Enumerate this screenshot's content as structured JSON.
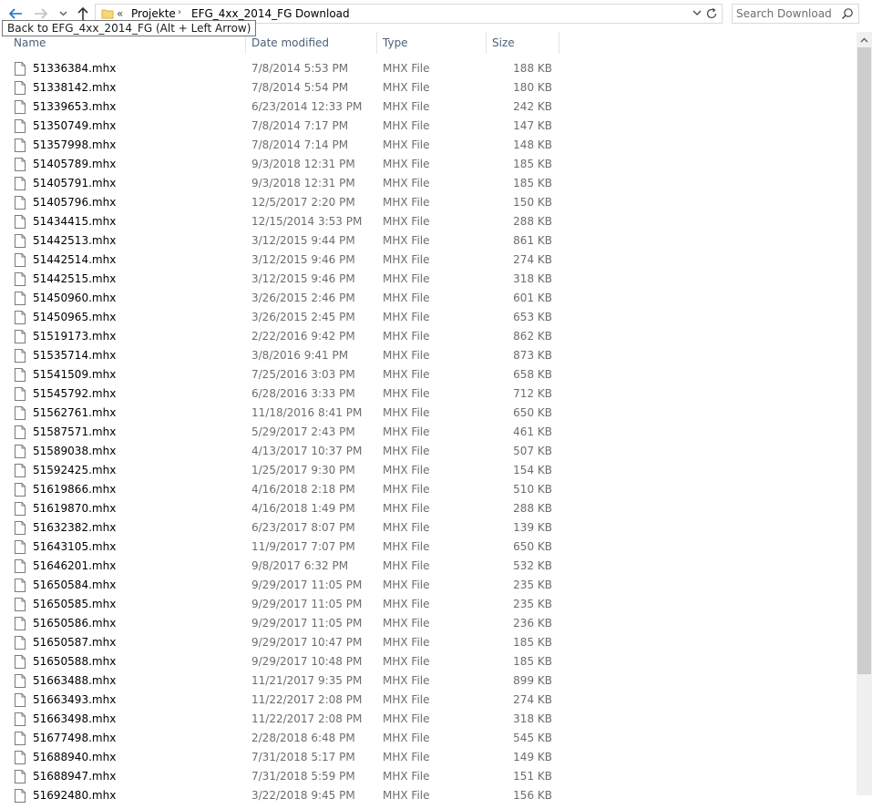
{
  "nav": {
    "back_icon": "arrow-left-icon",
    "forward_icon": "arrow-right-icon",
    "recent_icon": "chevron-down-icon",
    "up_icon": "arrow-up-icon"
  },
  "address": {
    "overflow": "«",
    "crumbs": [
      "Projekte",
      "EFG_4xx_2014_FG",
      "Download"
    ],
    "separator": "›"
  },
  "search": {
    "placeholder": "Search Download"
  },
  "tooltip": "Back to EFG_4xx_2014_FG (Alt + Left Arrow)",
  "columns": {
    "name": "Name",
    "date": "Date modified",
    "type": "Type",
    "size": "Size"
  },
  "files": [
    {
      "name": "51336384.mhx",
      "date": "7/8/2014 5:53 PM",
      "type": "MHX File",
      "size": "188 KB"
    },
    {
      "name": "51338142.mhx",
      "date": "7/8/2014 5:54 PM",
      "type": "MHX File",
      "size": "180 KB"
    },
    {
      "name": "51339653.mhx",
      "date": "6/23/2014 12:33 PM",
      "type": "MHX File",
      "size": "242 KB"
    },
    {
      "name": "51350749.mhx",
      "date": "7/8/2014 7:17 PM",
      "type": "MHX File",
      "size": "147 KB"
    },
    {
      "name": "51357998.mhx",
      "date": "7/8/2014 7:14 PM",
      "type": "MHX File",
      "size": "148 KB"
    },
    {
      "name": "51405789.mhx",
      "date": "9/3/2018 12:31 PM",
      "type": "MHX File",
      "size": "185 KB"
    },
    {
      "name": "51405791.mhx",
      "date": "9/3/2018 12:31 PM",
      "type": "MHX File",
      "size": "185 KB"
    },
    {
      "name": "51405796.mhx",
      "date": "12/5/2017 2:20 PM",
      "type": "MHX File",
      "size": "150 KB"
    },
    {
      "name": "51434415.mhx",
      "date": "12/15/2014 3:53 PM",
      "type": "MHX File",
      "size": "288 KB"
    },
    {
      "name": "51442513.mhx",
      "date": "3/12/2015 9:44 PM",
      "type": "MHX File",
      "size": "861 KB"
    },
    {
      "name": "51442514.mhx",
      "date": "3/12/2015 9:46 PM",
      "type": "MHX File",
      "size": "274 KB"
    },
    {
      "name": "51442515.mhx",
      "date": "3/12/2015 9:46 PM",
      "type": "MHX File",
      "size": "318 KB"
    },
    {
      "name": "51450960.mhx",
      "date": "3/26/2015 2:46 PM",
      "type": "MHX File",
      "size": "601 KB"
    },
    {
      "name": "51450965.mhx",
      "date": "3/26/2015 2:45 PM",
      "type": "MHX File",
      "size": "653 KB"
    },
    {
      "name": "51519173.mhx",
      "date": "2/22/2016 9:42 PM",
      "type": "MHX File",
      "size": "862 KB"
    },
    {
      "name": "51535714.mhx",
      "date": "3/8/2016 9:41 PM",
      "type": "MHX File",
      "size": "873 KB"
    },
    {
      "name": "51541509.mhx",
      "date": "7/25/2016 3:03 PM",
      "type": "MHX File",
      "size": "658 KB"
    },
    {
      "name": "51545792.mhx",
      "date": "6/28/2016 3:33 PM",
      "type": "MHX File",
      "size": "712 KB"
    },
    {
      "name": "51562761.mhx",
      "date": "11/18/2016 8:41 PM",
      "type": "MHX File",
      "size": "650 KB"
    },
    {
      "name": "51587571.mhx",
      "date": "5/29/2017 2:43 PM",
      "type": "MHX File",
      "size": "461 KB"
    },
    {
      "name": "51589038.mhx",
      "date": "4/13/2017 10:37 PM",
      "type": "MHX File",
      "size": "507 KB"
    },
    {
      "name": "51592425.mhx",
      "date": "1/25/2017 9:30 PM",
      "type": "MHX File",
      "size": "154 KB"
    },
    {
      "name": "51619866.mhx",
      "date": "4/16/2018 2:18 PM",
      "type": "MHX File",
      "size": "510 KB"
    },
    {
      "name": "51619870.mhx",
      "date": "4/16/2018 1:49 PM",
      "type": "MHX File",
      "size": "288 KB"
    },
    {
      "name": "51632382.mhx",
      "date": "6/23/2017 8:07 PM",
      "type": "MHX File",
      "size": "139 KB"
    },
    {
      "name": "51643105.mhx",
      "date": "11/9/2017 7:07 PM",
      "type": "MHX File",
      "size": "650 KB"
    },
    {
      "name": "51646201.mhx",
      "date": "9/8/2017 6:32 PM",
      "type": "MHX File",
      "size": "532 KB"
    },
    {
      "name": "51650584.mhx",
      "date": "9/29/2017 11:05 PM",
      "type": "MHX File",
      "size": "235 KB"
    },
    {
      "name": "51650585.mhx",
      "date": "9/29/2017 11:05 PM",
      "type": "MHX File",
      "size": "235 KB"
    },
    {
      "name": "51650586.mhx",
      "date": "9/29/2017 11:05 PM",
      "type": "MHX File",
      "size": "236 KB"
    },
    {
      "name": "51650587.mhx",
      "date": "9/29/2017 10:47 PM",
      "type": "MHX File",
      "size": "185 KB"
    },
    {
      "name": "51650588.mhx",
      "date": "9/29/2017 10:48 PM",
      "type": "MHX File",
      "size": "185 KB"
    },
    {
      "name": "51663488.mhx",
      "date": "11/21/2017 9:35 PM",
      "type": "MHX File",
      "size": "899 KB"
    },
    {
      "name": "51663493.mhx",
      "date": "11/22/2017 2:08 PM",
      "type": "MHX File",
      "size": "274 KB"
    },
    {
      "name": "51663498.mhx",
      "date": "11/22/2017 2:08 PM",
      "type": "MHX File",
      "size": "318 KB"
    },
    {
      "name": "51677498.mhx",
      "date": "2/28/2018 6:48 PM",
      "type": "MHX File",
      "size": "545 KB"
    },
    {
      "name": "51688940.mhx",
      "date": "7/31/2018 5:17 PM",
      "type": "MHX File",
      "size": "149 KB"
    },
    {
      "name": "51688947.mhx",
      "date": "7/31/2018 5:59 PM",
      "type": "MHX File",
      "size": "151 KB"
    },
    {
      "name": "51692480.mhx",
      "date": "3/22/2018 9:45 PM",
      "type": "MHX File",
      "size": "156 KB"
    }
  ],
  "colors": {
    "accent": "#1f6fbf",
    "header_text": "#4c607a",
    "secondary_text": "#6d6d6d"
  }
}
